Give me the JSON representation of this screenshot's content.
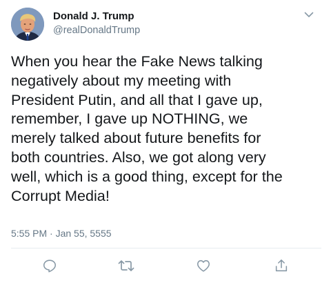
{
  "tweet": {
    "author_name": "Donald J. Trump",
    "author_handle": "@realDonaldTrump",
    "text_lines": [
      "When you hear the Fake News talking",
      "negatively about my meeting with",
      "President Putin, and all that I gave up,",
      "remember, I gave up NOTHING, we",
      "merely talked about future benefits for",
      "both countries. Also, we got along very",
      "well, which is a good thing, except for the",
      "Corrupt Media!"
    ],
    "timestamp": "5:55 PM · Jan 55, 5555"
  },
  "icons": {
    "menu": "chevron-down-icon",
    "reply": "reply-icon",
    "retweet": "retweet-icon",
    "like": "heart-icon",
    "share": "share-icon"
  },
  "colors": {
    "text": "#14171a",
    "secondary": "#657786",
    "divider": "#e6ecf0"
  }
}
